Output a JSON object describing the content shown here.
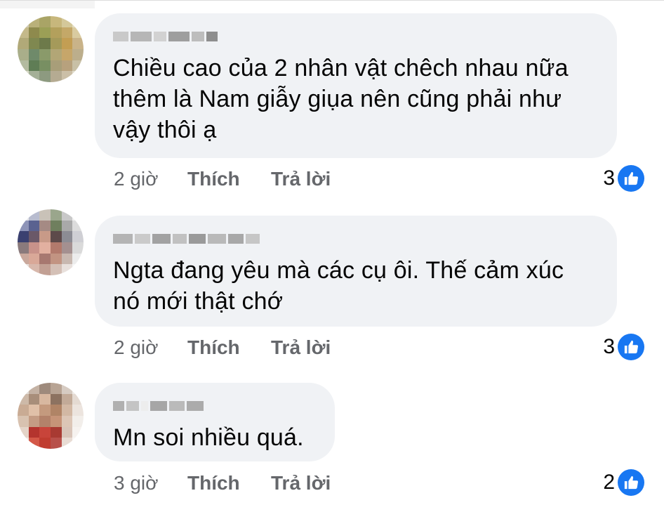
{
  "comments": [
    {
      "text": "Chiều cao của 2 nhân vật chêch nhau nữa thêm là Nam giẫy giụa  nên cũng phải như vậy thôi ạ",
      "lines": [
        "Chiều cao của 2 nhân vật chêch nhau nữa",
        "thêm là Nam giẫy giụa  nên cũng phải như",
        "vậy thôi ạ"
      ],
      "time": "2 giờ",
      "like_label": "Thích",
      "reply_label": "Trả lời",
      "reaction_count": "3",
      "reaction_icon": "thumbs-up-icon"
    },
    {
      "text": "Ngta đang yêu mà các cụ ôi. Thế cảm xúc nó mới thật chớ",
      "lines": [
        "Ngta đang yêu mà các cụ ôi. Thế cảm xúc",
        "nó mới thật chớ"
      ],
      "time": "2 giờ",
      "like_label": "Thích",
      "reply_label": "Trả lời",
      "reaction_count": "3",
      "reaction_icon": "thumbs-up-icon"
    },
    {
      "text": "Mn soi nhiều quá.",
      "lines": [
        "Mn soi nhiều quá."
      ],
      "time": "3 giờ",
      "like_label": "Thích",
      "reply_label": "Trả lời",
      "reaction_count": "2",
      "reaction_icon": "thumbs-up-icon"
    }
  ],
  "colors": {
    "bubble_bg": "#f0f2f5",
    "meta_text": "#65676b",
    "body_text": "#050505",
    "like_blue": "#1877f2"
  }
}
